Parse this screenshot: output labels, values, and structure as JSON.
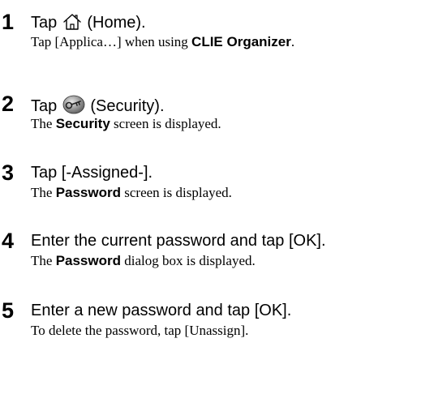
{
  "steps": [
    {
      "number": "1",
      "title_before": "Tap",
      "icon": "home-icon",
      "title_after": "(Home).",
      "desc_before": "Tap [Applica…] when using ",
      "desc_bold": "CLIE Organizer",
      "desc_after": "."
    },
    {
      "number": "2",
      "title_before": "Tap",
      "icon": "security-key-icon",
      "title_after": "(Security).",
      "desc_before": "The ",
      "desc_bold": "Security",
      "desc_after": " screen is displayed."
    },
    {
      "number": "3",
      "title": "Tap [-Assigned-].",
      "desc_before": "The ",
      "desc_bold": "Password",
      "desc_after": " screen is displayed."
    },
    {
      "number": "4",
      "title": "Enter the current password and tap [OK].",
      "desc_before": "The ",
      "desc_bold": "Password",
      "desc_after": " dialog box is displayed."
    },
    {
      "number": "5",
      "title": "Enter a new password and tap [OK].",
      "desc": "To delete the password, tap [Unassign]."
    }
  ]
}
